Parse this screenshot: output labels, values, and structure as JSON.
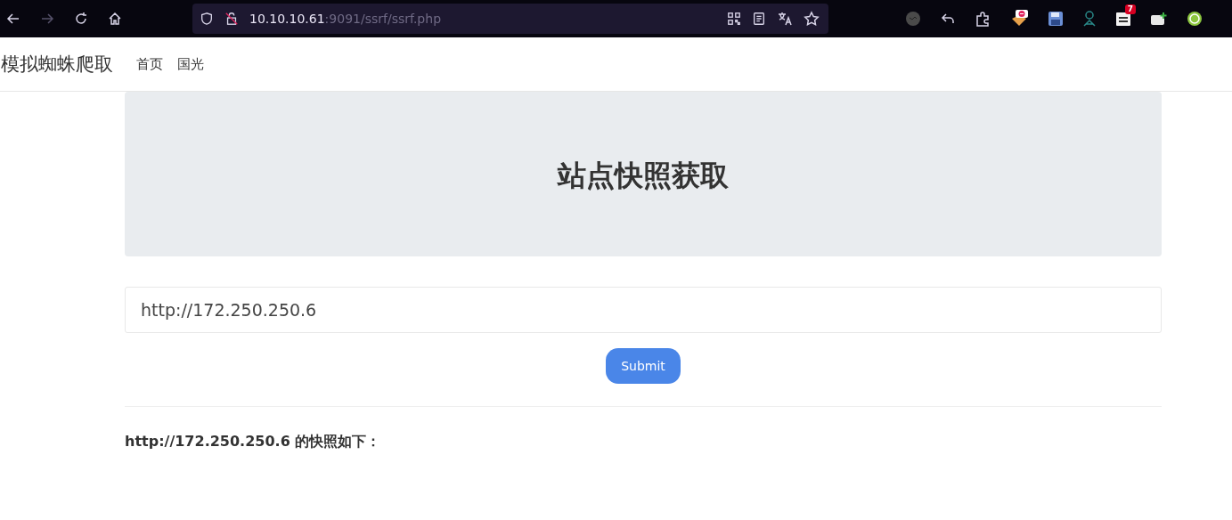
{
  "browser": {
    "url_host": "10.10.10.61",
    "url_path": ":9091/ssrf/ssrf.php",
    "extension_badge": "7"
  },
  "navbar": {
    "brand": "模拟蜘蛛爬取",
    "links": [
      {
        "label": "首页"
      },
      {
        "label": "国光"
      }
    ]
  },
  "jumbotron": {
    "title": "站点快照获取"
  },
  "form": {
    "url_value": "http://172.250.250.6",
    "submit": "Submit"
  },
  "result": {
    "text": "http://172.250.250.6 的快照如下："
  }
}
